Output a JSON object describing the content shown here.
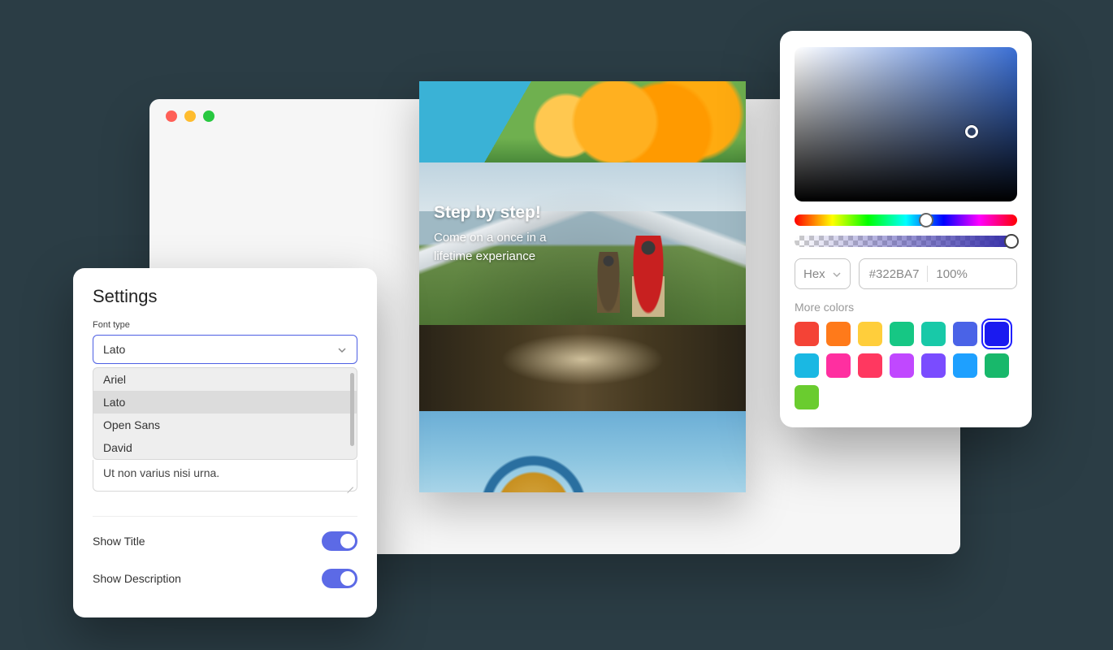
{
  "settings": {
    "title": "Settings",
    "font_type_label": "Font type",
    "font_selected": "Lato",
    "font_options": [
      "Ariel",
      "Lato",
      "Open Sans",
      "David"
    ],
    "sample_text": "Ut non varius nisi urna.",
    "toggles": {
      "show_title": {
        "label": "Show Title",
        "on": true
      },
      "show_desc": {
        "label": "Show Description",
        "on": true
      }
    }
  },
  "preview": {
    "headline": "Step by step!",
    "subline1": "Come on a once in a",
    "subline2": "lifetime experiance"
  },
  "colorpicker": {
    "format": "Hex",
    "hex": "#322BA7",
    "alpha": "100%",
    "more_colors_label": "More colors",
    "swatches": [
      {
        "c": "#f44336"
      },
      {
        "c": "#ff7a1a"
      },
      {
        "c": "#ffce3b"
      },
      {
        "c": "#16c784"
      },
      {
        "c": "#18c9a8"
      },
      {
        "c": "#4a63e7"
      },
      {
        "c": "#1a1af0",
        "selected": true
      },
      {
        "c": "#1ab8e3"
      },
      {
        "c": "#ff2fa0"
      },
      {
        "c": "#ff3860"
      },
      {
        "c": "#c048ff"
      },
      {
        "c": "#7a4cff"
      },
      {
        "c": "#1ea0ff"
      },
      {
        "c": "#18b86b"
      },
      {
        "c": "#6acc2f"
      }
    ]
  }
}
